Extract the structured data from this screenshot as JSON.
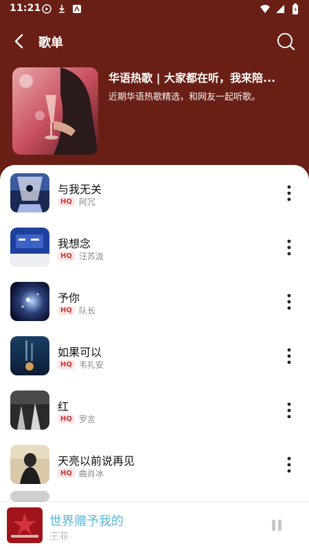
{
  "status_bar": {
    "time": "11:21"
  },
  "header": {
    "title": "歌单",
    "back_icon": "chevron-left-icon",
    "search_icon": "search-icon"
  },
  "playlist": {
    "name": "华语热歌 | 大家都在听，我来陪...",
    "description": "近期华语热歌精选，和网友一起听歌。"
  },
  "songs": [
    {
      "title": "与我无关",
      "quality": "HQ",
      "artist": "阿冗"
    },
    {
      "title": "我想念",
      "quality": "HQ",
      "artist": "汪苏泷"
    },
    {
      "title": "予你",
      "quality": "HQ",
      "artist": "队长"
    },
    {
      "title": "如果可以",
      "quality": "HQ",
      "artist": "韦礼安"
    },
    {
      "title": "红",
      "quality": "HQ",
      "artist": "罗言"
    },
    {
      "title": "天亮以前说再见",
      "quality": "HQ",
      "artist": "曲肖冰"
    }
  ],
  "mini_player": {
    "title": "世界赠予我的",
    "artist": "王菲",
    "state_icon": "pause-icon"
  },
  "colors": {
    "header_bg": "#6a1f16",
    "accent_title": "#5ab6d6",
    "hq_badge_bg": "#fde5e5",
    "hq_badge_text": "#c23a3a"
  }
}
